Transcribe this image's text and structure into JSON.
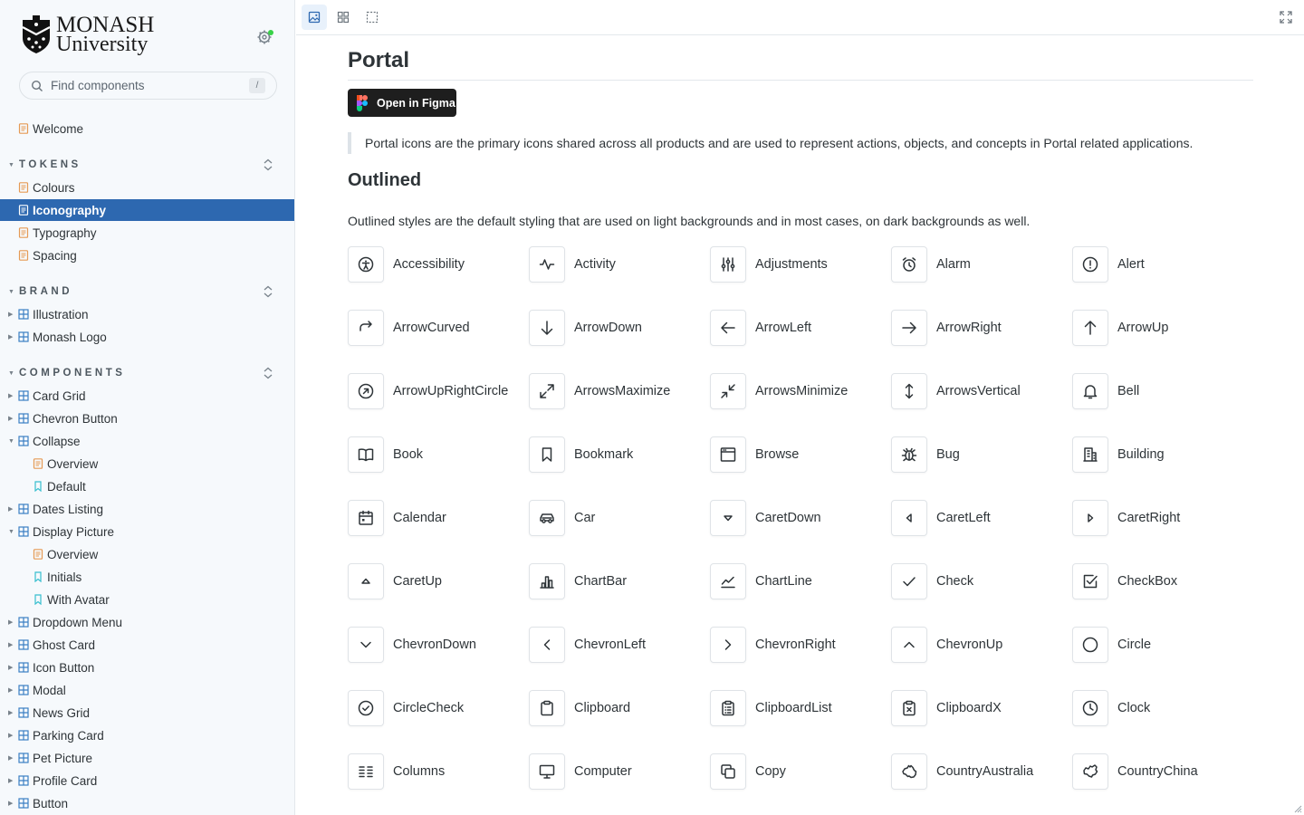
{
  "brand": {
    "line1": "MONASH",
    "line2": "University"
  },
  "search": {
    "placeholder": "Find components",
    "shortcut": "/"
  },
  "sidebar": {
    "items": [
      {
        "kind": "doc",
        "label": "Welcome",
        "indent": 0
      },
      {
        "kind": "section",
        "label": "TOKENS"
      },
      {
        "kind": "doc",
        "label": "Colours",
        "indent": 0
      },
      {
        "kind": "doc",
        "label": "Iconography",
        "indent": 0,
        "selected": true
      },
      {
        "kind": "doc",
        "label": "Typography",
        "indent": 0
      },
      {
        "kind": "doc",
        "label": "Spacing",
        "indent": 0
      },
      {
        "kind": "section",
        "label": "BRAND"
      },
      {
        "kind": "component",
        "label": "Illustration",
        "indent": 0,
        "expanded": false
      },
      {
        "kind": "component",
        "label": "Monash Logo",
        "indent": 0,
        "expanded": false
      },
      {
        "kind": "section",
        "label": "COMPONENTS"
      },
      {
        "kind": "component",
        "label": "Card Grid",
        "indent": 0,
        "expanded": false
      },
      {
        "kind": "component",
        "label": "Chevron Button",
        "indent": 0,
        "expanded": false
      },
      {
        "kind": "component",
        "label": "Collapse",
        "indent": 0,
        "expanded": true
      },
      {
        "kind": "doc",
        "label": "Overview",
        "indent": 1
      },
      {
        "kind": "story",
        "label": "Default",
        "indent": 1
      },
      {
        "kind": "component",
        "label": "Dates Listing",
        "indent": 0,
        "expanded": false
      },
      {
        "kind": "component",
        "label": "Display Picture",
        "indent": 0,
        "expanded": true
      },
      {
        "kind": "doc",
        "label": "Overview",
        "indent": 1
      },
      {
        "kind": "story",
        "label": "Initials",
        "indent": 1
      },
      {
        "kind": "story",
        "label": "With Avatar",
        "indent": 1
      },
      {
        "kind": "component",
        "label": "Dropdown Menu",
        "indent": 0,
        "expanded": false
      },
      {
        "kind": "component",
        "label": "Ghost Card",
        "indent": 0,
        "expanded": false
      },
      {
        "kind": "component",
        "label": "Icon Button",
        "indent": 0,
        "expanded": false
      },
      {
        "kind": "component",
        "label": "Modal",
        "indent": 0,
        "expanded": false
      },
      {
        "kind": "component",
        "label": "News Grid",
        "indent": 0,
        "expanded": false
      },
      {
        "kind": "component",
        "label": "Parking Card",
        "indent": 0,
        "expanded": false
      },
      {
        "kind": "component",
        "label": "Pet Picture",
        "indent": 0,
        "expanded": false
      },
      {
        "kind": "component",
        "label": "Profile Card",
        "indent": 0,
        "expanded": false
      },
      {
        "kind": "component",
        "label": "Button",
        "indent": 0,
        "expanded": false
      }
    ]
  },
  "toolbar": {
    "canvas_tab": "canvas-icon",
    "grid_tab": "grid-icon",
    "outline_tab": "outline-icon",
    "fullscreen": "fullscreen-icon"
  },
  "main": {
    "title": "Portal",
    "figma_button": "Open in Figma",
    "intro": "Portal icons are the primary icons shared across all products and are used to represent actions, objects, and concepts in Portal related applications.",
    "section_title": "Outlined",
    "section_desc": "Outlined styles are the default styling that are used on light backgrounds and in most cases, on dark backgrounds as well.",
    "icons": [
      "Accessibility",
      "Activity",
      "Adjustments",
      "Alarm",
      "Alert",
      "ArrowCurved",
      "ArrowDown",
      "ArrowLeft",
      "ArrowRight",
      "ArrowUp",
      "ArrowUpRightCircle",
      "ArrowsMaximize",
      "ArrowsMinimize",
      "ArrowsVertical",
      "Bell",
      "Book",
      "Bookmark",
      "Browse",
      "Bug",
      "Building",
      "Calendar",
      "Car",
      "CaretDown",
      "CaretLeft",
      "CaretRight",
      "CaretUp",
      "ChartBar",
      "ChartLine",
      "Check",
      "CheckBox",
      "ChevronDown",
      "ChevronLeft",
      "ChevronRight",
      "ChevronUp",
      "Circle",
      "CircleCheck",
      "Clipboard",
      "ClipboardList",
      "ClipboardX",
      "Clock",
      "Columns",
      "Computer",
      "Copy",
      "CountryAustralia",
      "CountryChina"
    ]
  },
  "colors": {
    "selected_bg": "#2d68b0",
    "doc_icon": "#e59a55",
    "component_icon": "#3b7fc4",
    "story_icon": "#37bfcf",
    "status_dot": "#37d247"
  }
}
